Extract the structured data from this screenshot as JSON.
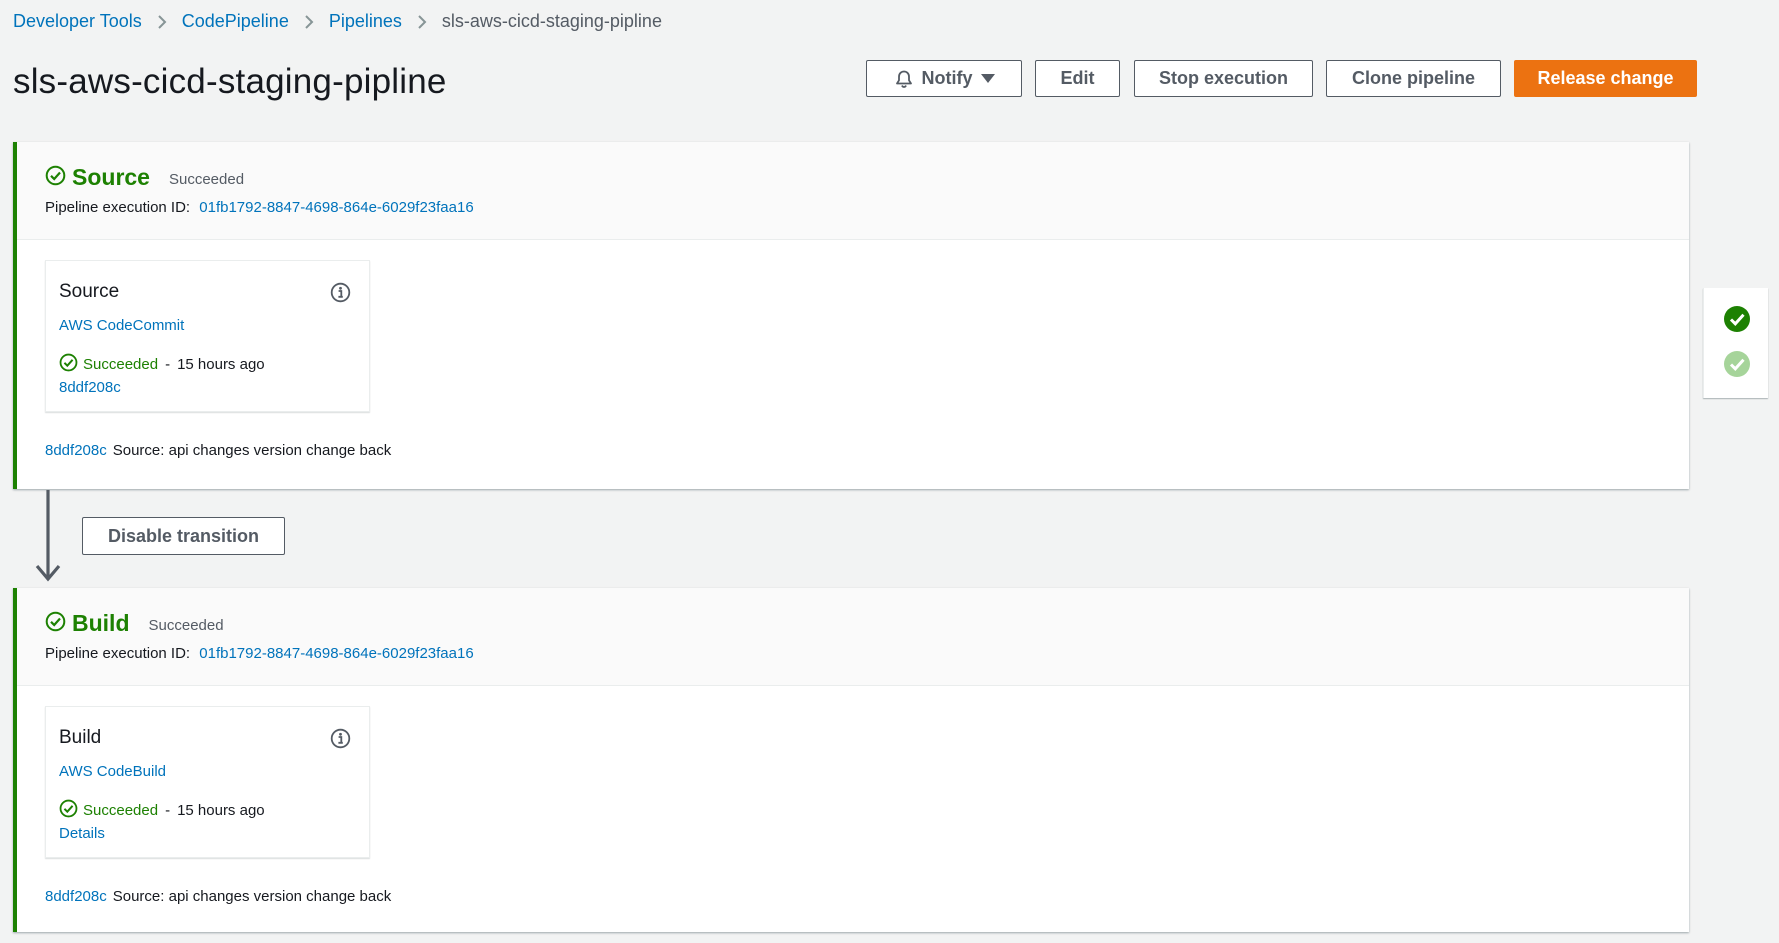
{
  "breadcrumb": {
    "items": [
      "Developer Tools",
      "CodePipeline",
      "Pipelines",
      "sls-aws-cicd-staging-pipline"
    ]
  },
  "page": {
    "title": "sls-aws-cicd-staging-pipline"
  },
  "actions": {
    "notify": "Notify",
    "edit": "Edit",
    "stop": "Stop execution",
    "clone": "Clone pipeline",
    "release": "Release change"
  },
  "stages": [
    {
      "name": "Source",
      "status": "Succeeded",
      "execution_label": "Pipeline execution ID:",
      "execution_id": "01fb1792-8847-4698-864e-6029f23faa16",
      "action": {
        "name": "Source",
        "provider": "AWS CodeCommit",
        "status": "Succeeded",
        "dash": "-",
        "time": "15 hours ago",
        "link": "8ddf208c"
      },
      "commit": {
        "id": "8ddf208c",
        "message": "Source: api changes version change back"
      }
    },
    {
      "name": "Build",
      "status": "Succeeded",
      "execution_label": "Pipeline execution ID:",
      "execution_id": "01fb1792-8847-4698-864e-6029f23faa16",
      "action": {
        "name": "Build",
        "provider": "AWS CodeBuild",
        "status": "Succeeded",
        "dash": "-",
        "time": "15 hours ago",
        "link": "Details"
      },
      "commit": {
        "id": "8ddf208c",
        "message": "Source: api changes version change back"
      }
    }
  ],
  "transition": {
    "button": "Disable transition"
  },
  "side_rail": {
    "icons": [
      "check-circle-filled-icon",
      "check-circle-light-icon"
    ]
  },
  "colors": {
    "success": "#1d8102",
    "link": "#0073bb",
    "primary": "#ec7211",
    "background": "#f2f3f3"
  }
}
